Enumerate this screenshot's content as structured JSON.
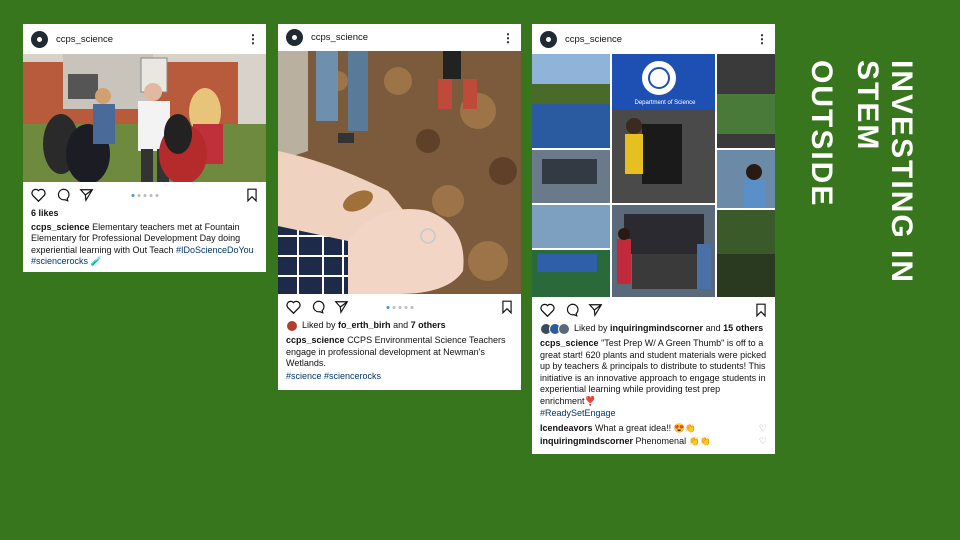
{
  "slide": {
    "title_line1": "INVESTING IN STEM",
    "title_line2": "OUTSIDE",
    "background": "#38761d"
  },
  "posts": [
    {
      "username": "ccps_science",
      "likes": "6 likes",
      "caption_user": "ccps_science",
      "caption": "Elementary teachers met at Fountain Elementary for Professional Development Day doing experiential learning with Out Teach",
      "hashtags": "#IDoScienceDoYou #sciencerocks 🧪"
    },
    {
      "username": "ccps_science",
      "liked_prefix": "Liked by",
      "liked_user": "fo_erth_birh",
      "liked_suffix": "and",
      "liked_others": "7 others",
      "caption_user": "ccps_science",
      "caption": "CCPS Environmental Science Teachers engage in professional development at Newman's Wetlands.",
      "hashtags": "#science #sciencerocks"
    },
    {
      "username": "ccps_science",
      "liked_prefix": "Liked by",
      "liked_user": "inquiringmindscorner",
      "liked_suffix": "and",
      "liked_others": "15 others",
      "caption_user": "ccps_science",
      "caption": "\"Test Prep W/ A Green Thumb\" is off to a great start! 620 plants and student materials were picked up by teachers & principals to distribute to students! This initiative is an innovative approach to engage students in experiential learning while providing test prep enrichment❣️",
      "hashtags": "#ReadySetEngage",
      "banner_text": "Department of Science",
      "comments": [
        {
          "user": "lcendeavors",
          "text": "What a great idea!! 😍👏"
        },
        {
          "user": "inquiringmindscorner",
          "text": "Phenomenal 👏👏"
        }
      ]
    }
  ]
}
